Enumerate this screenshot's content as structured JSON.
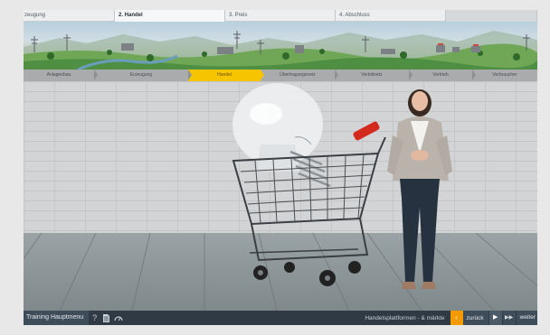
{
  "tabs": [
    {
      "label": "zeugung"
    },
    {
      "label": "2. Handel"
    },
    {
      "label": "3. Preis"
    },
    {
      "label": "4. Abschluss"
    }
  ],
  "process_steps": [
    {
      "label": "Anlagenbau"
    },
    {
      "label": "Erzeugung"
    },
    {
      "label": "Handel"
    },
    {
      "label": "Übertragungsnetz"
    },
    {
      "label": "Verteilnetz"
    },
    {
      "label": "Vertrieb"
    },
    {
      "label": "Verbraucher"
    }
  ],
  "active_step": "Handel",
  "bottombar": {
    "main_menu_label": "Training Hauptmenu",
    "help_icon": "question-mark-icon",
    "doc_icon": "document-icon",
    "speed_icon": "gauge-icon",
    "chapter_title": "Handelsplattformen - & märkte",
    "back_label": "zurück",
    "next_label": "weiter"
  },
  "colors": {
    "accent": "#f39a00",
    "active_step": "#f6c400",
    "bar": "#2f3a45",
    "cart_handle": "#d42a1e"
  }
}
